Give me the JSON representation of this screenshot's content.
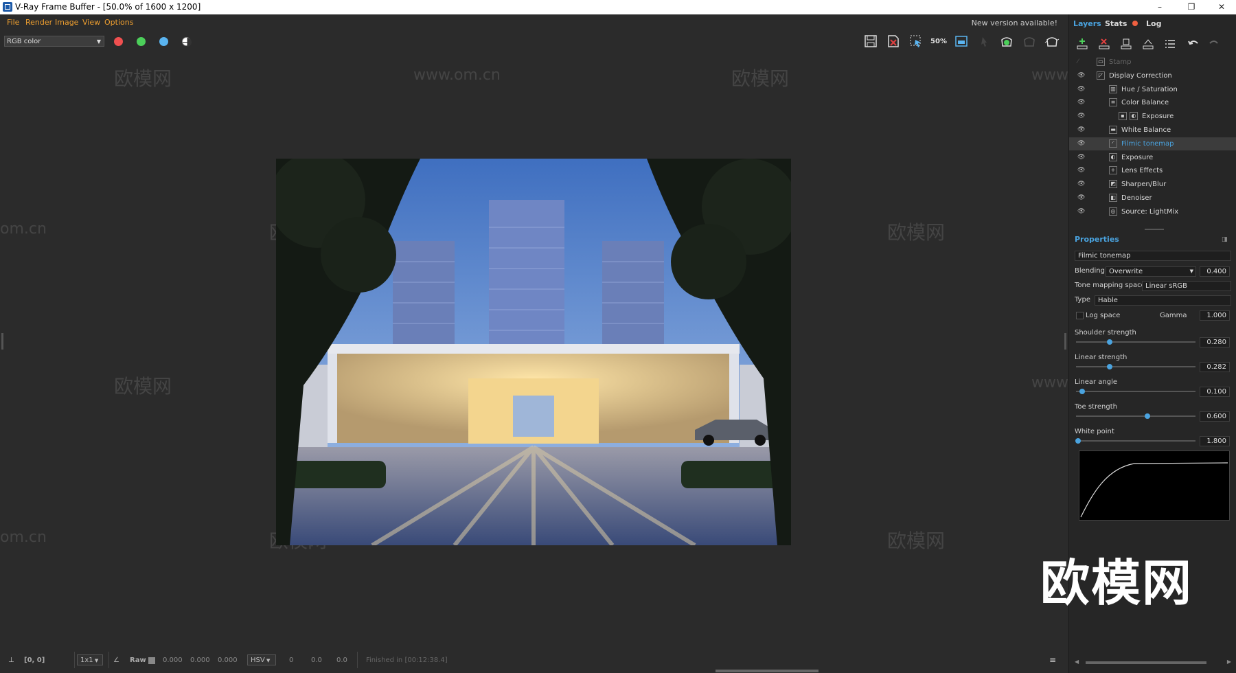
{
  "window": {
    "title": "V-Ray Frame Buffer - [50.0% of 1600 x 1200]",
    "controls": [
      "–",
      "❐",
      "✕"
    ]
  },
  "menu": {
    "items": [
      "File",
      "Render",
      "Image",
      "View",
      "Options"
    ],
    "notice": "New version available!"
  },
  "toolbar": {
    "channel": "RGB color",
    "channel_dots": [
      "#f05050",
      "#4ccf5a",
      "#5ab4f0"
    ],
    "zoom_label": "50%"
  },
  "right_panel": {
    "tabs": [
      "Layers",
      "Stats",
      "Log"
    ],
    "layers": [
      {
        "label": "Stamp",
        "indent": 0,
        "icon": "stamp-icon",
        "visible": false
      },
      {
        "label": "Display Correction",
        "indent": 0,
        "icon": "folder-icon",
        "visible": true
      },
      {
        "label": "Hue / Saturation",
        "indent": 1,
        "icon": "hue-icon",
        "visible": true
      },
      {
        "label": "Color Balance",
        "indent": 1,
        "icon": "balance-icon",
        "visible": true
      },
      {
        "label": "Exposure",
        "indent": 2,
        "icon": "exposure-icon",
        "visible": true
      },
      {
        "label": "White Balance",
        "indent": 1,
        "icon": "white-balance-icon",
        "visible": true
      },
      {
        "label": "Filmic tonemap",
        "indent": 1,
        "icon": "tonemap-icon",
        "visible": true,
        "selected": true
      },
      {
        "label": "Exposure",
        "indent": 1,
        "icon": "exposure-icon",
        "visible": true
      },
      {
        "label": "Lens Effects",
        "indent": 1,
        "icon": "lens-icon",
        "visible": true
      },
      {
        "label": "Sharpen/Blur",
        "indent": 1,
        "icon": "sharpen-icon",
        "visible": true
      },
      {
        "label": "Denoiser",
        "indent": 1,
        "icon": "denoiser-icon",
        "visible": true
      },
      {
        "label": "Source: LightMix",
        "indent": 1,
        "icon": "lightmix-icon",
        "visible": true
      }
    ],
    "properties": {
      "header": "Properties",
      "layer_name": "Filmic tonemap",
      "blending_label": "Blending",
      "blending_value": "Overwrite",
      "blending_amount": "0.400",
      "tone_space_label": "Tone mapping space",
      "tone_space_value": "Linear sRGB",
      "type_label": "Type",
      "type_value": "Hable",
      "log_space_label": "Log space",
      "gamma_label": "Gamma",
      "gamma_value": "1.000",
      "sliders": [
        {
          "label": "Shoulder strength",
          "value": "0.280",
          "fraction": 0.28
        },
        {
          "label": "Linear strength",
          "value": "0.282",
          "fraction": 0.282
        },
        {
          "label": "Linear angle",
          "value": "0.100",
          "fraction": 0.05
        },
        {
          "label": "Toe strength",
          "value": "0.600",
          "fraction": 0.6
        },
        {
          "label": "White point",
          "value": "1.800",
          "fraction": 0.02
        }
      ]
    }
  },
  "status": {
    "coords": "[0, 0]",
    "zoom": "1x1",
    "mode": "Raw",
    "rgb": [
      "0.000",
      "0.000",
      "0.000"
    ],
    "colorspace": "HSV",
    "hsv": [
      "0",
      "0.0",
      "0.0"
    ],
    "finished": "Finished in [00:12:38.4]"
  },
  "watermark": {
    "text": "欧模网",
    "url": "www.om.cn",
    "url_short": "om.cn",
    "url_partial": "www."
  },
  "brand_logo": "欧模网",
  "colors": {
    "accent": "#4aa3df",
    "menu": "#f0a030",
    "background": "#2b2b2b",
    "panel": "#262626"
  }
}
